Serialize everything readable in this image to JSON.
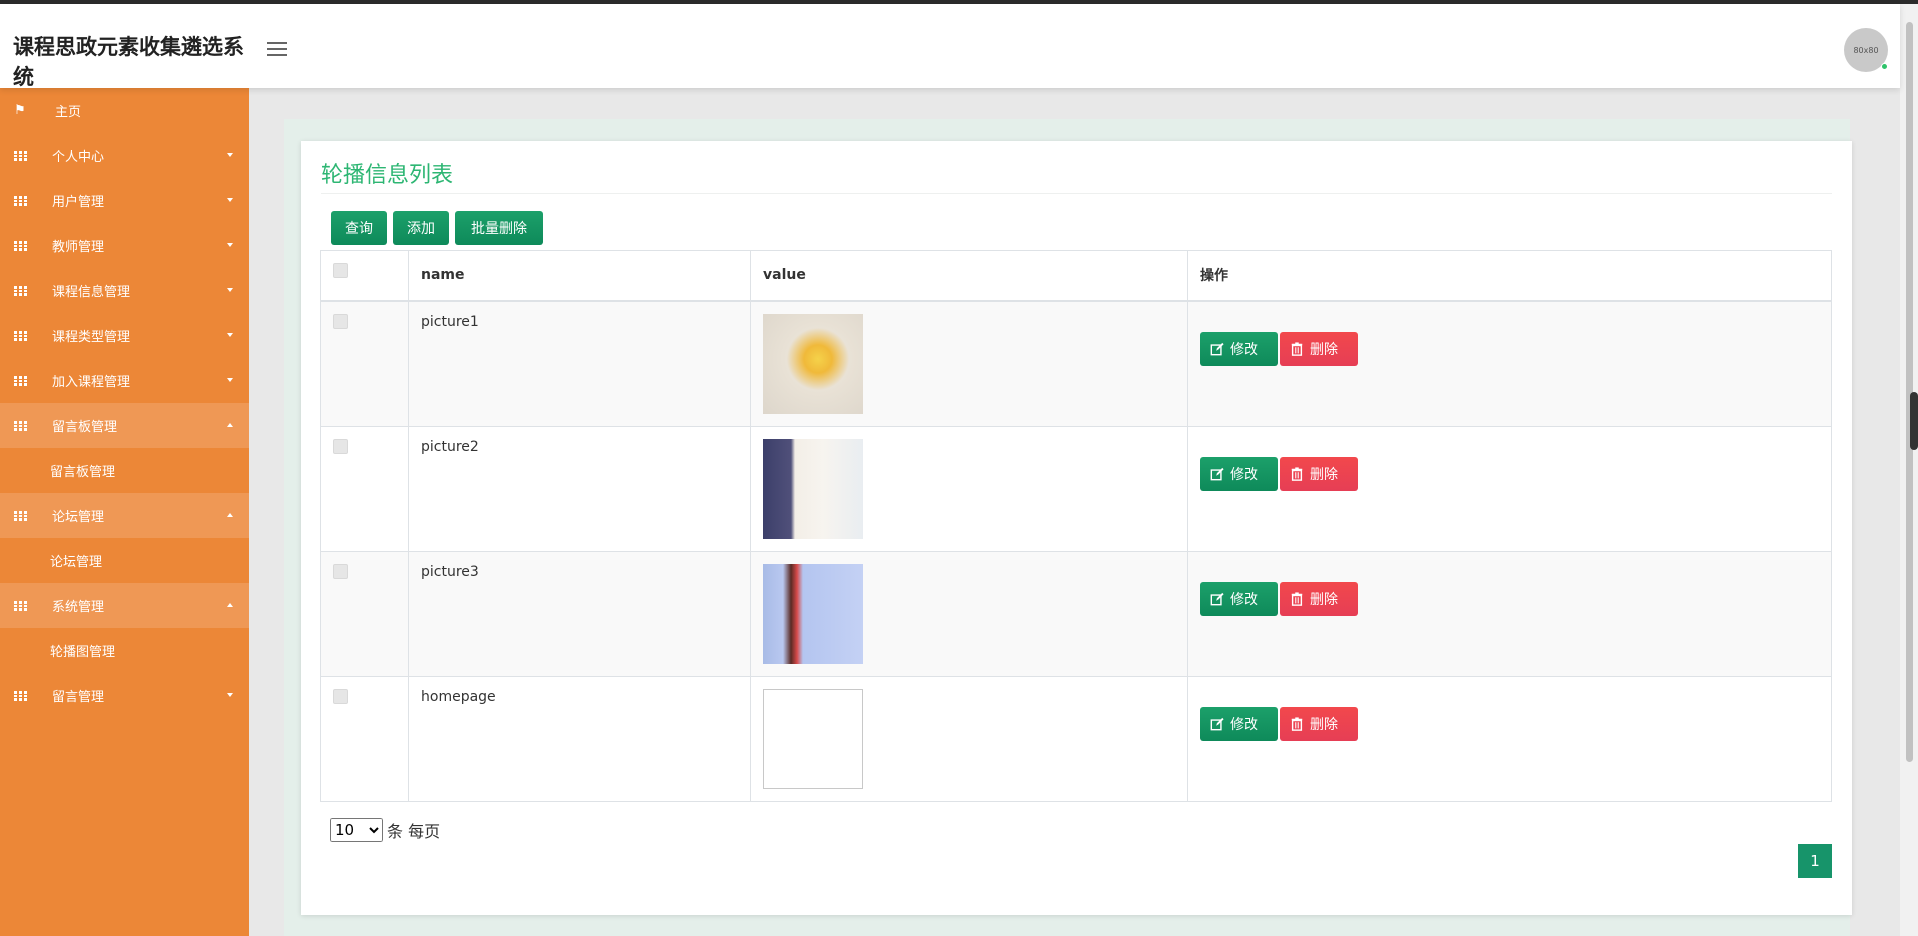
{
  "header": {
    "brand": "课程思政元素收集遴选系统",
    "avatar_text": "80x80"
  },
  "sidebar": {
    "items": [
      {
        "label": "主页",
        "icon": "flag-icon",
        "open": false,
        "caret": "none"
      },
      {
        "label": "个人中心",
        "icon": "grid-icon",
        "caret": "down"
      },
      {
        "label": "用户管理",
        "icon": "grid-icon",
        "caret": "down"
      },
      {
        "label": "教师管理",
        "icon": "grid-icon",
        "caret": "down"
      },
      {
        "label": "课程信息管理",
        "icon": "grid-icon",
        "caret": "down"
      },
      {
        "label": "课程类型管理",
        "icon": "grid-icon",
        "caret": "down"
      },
      {
        "label": "加入课程管理",
        "icon": "grid-icon",
        "caret": "down"
      },
      {
        "label": "留言板管理",
        "icon": "grid-icon",
        "caret": "up",
        "sub": "留言板管理"
      },
      {
        "label": "论坛管理",
        "icon": "grid-icon",
        "caret": "up",
        "sub": "论坛管理"
      },
      {
        "label": "系统管理",
        "icon": "grid-icon",
        "caret": "up",
        "sub": "轮播图管理"
      },
      {
        "label": "留言管理",
        "icon": "grid-icon",
        "caret": "down"
      }
    ]
  },
  "main": {
    "title": "轮播信息列表",
    "toolbar": {
      "query": "查询",
      "add": "添加",
      "bulk_delete": "批量删除"
    },
    "table": {
      "headers": [
        "name",
        "value",
        "操作"
      ],
      "rows": [
        {
          "name": "picture1",
          "thumb": "t1"
        },
        {
          "name": "picture2",
          "thumb": "t2"
        },
        {
          "name": "picture3",
          "thumb": "t3"
        },
        {
          "name": "homepage",
          "thumb": "t4"
        }
      ],
      "edit_label": "修改",
      "delete_label": "删除"
    },
    "pager": {
      "page_size": "10",
      "page_size_options": [
        "10"
      ],
      "per_page_label": "条 每页",
      "current_page": "1"
    }
  },
  "colors": {
    "sidebar": "#ec8737",
    "accent_green": "#17946a",
    "title_green": "#2db673",
    "danger": "#f2484c"
  }
}
